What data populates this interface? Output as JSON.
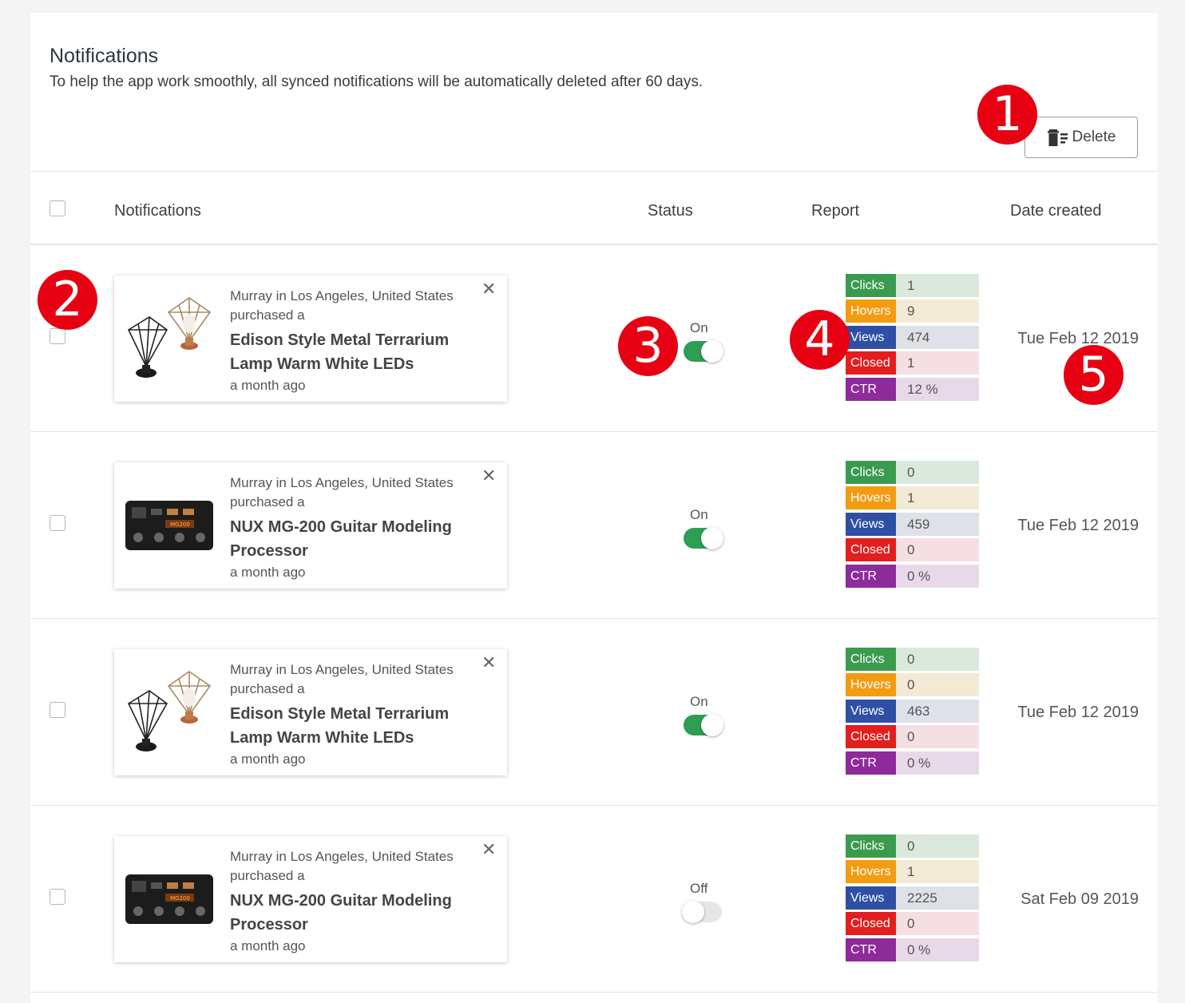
{
  "header": {
    "title": "Notifications",
    "subtitle": "To help the app work smoothly, all synced notifications will be automatically deleted after 60 days.",
    "delete_label": "Delete"
  },
  "columns": {
    "notifications": "Notifications",
    "status": "Status",
    "report": "Report",
    "date": "Date created"
  },
  "report_labels": {
    "clicks": "Clicks",
    "hovers": "Hovers",
    "views": "Views",
    "closed": "Closed",
    "ctr": "CTR"
  },
  "colors": {
    "clicks": "#3a9b4f",
    "clicks_bg": "#dbe9dd",
    "hovers": "#f39c12",
    "hovers_bg": "#f3ead6",
    "views": "#2e4fa3",
    "views_bg": "#dfe1e8",
    "closed": "#e41d1d",
    "closed_bg": "#f5dfe2",
    "ctr": "#8e2a9a",
    "ctr_bg": "#e8d9e8",
    "toggle_on": "#2e9e54",
    "callout": "#e60012"
  },
  "rows": [
    {
      "line1": "Murray in Los Angeles, United States",
      "line2": "purchased a",
      "product": "Edison Style Metal Terrarium Lamp Warm White LEDs",
      "time": "a month ago",
      "image": "lamp",
      "status": "On",
      "status_on": true,
      "clicks": "1",
      "hovers": "9",
      "views": "474",
      "closed": "1",
      "ctr": "12 %",
      "date": "Tue Feb 12 2019"
    },
    {
      "line1": "Murray in Los Angeles, United States",
      "line2": "purchased a",
      "product": "NUX MG-200 Guitar Modeling Processor",
      "time": "a month ago",
      "image": "guitar-processor",
      "status": "On",
      "status_on": true,
      "clicks": "0",
      "hovers": "1",
      "views": "459",
      "closed": "0",
      "ctr": "0 %",
      "date": "Tue Feb 12 2019"
    },
    {
      "line1": "Murray in Los Angeles, United States",
      "line2": "purchased a",
      "product": "Edison Style Metal Terrarium Lamp Warm White LEDs",
      "time": "a month ago",
      "image": "lamp",
      "status": "On",
      "status_on": true,
      "clicks": "0",
      "hovers": "0",
      "views": "463",
      "closed": "0",
      "ctr": "0 %",
      "date": "Tue Feb 12 2019"
    },
    {
      "line1": "Murray in Los Angeles, United States",
      "line2": "purchased a",
      "product": "NUX MG-200 Guitar Modeling Processor",
      "time": "a month ago",
      "image": "guitar-processor",
      "status": "Off",
      "status_on": false,
      "clicks": "0",
      "hovers": "1",
      "views": "2225",
      "closed": "0",
      "ctr": "0 %",
      "date": "Sat Feb 09 2019"
    }
  ],
  "callouts": [
    "1",
    "2",
    "3",
    "4",
    "5"
  ]
}
